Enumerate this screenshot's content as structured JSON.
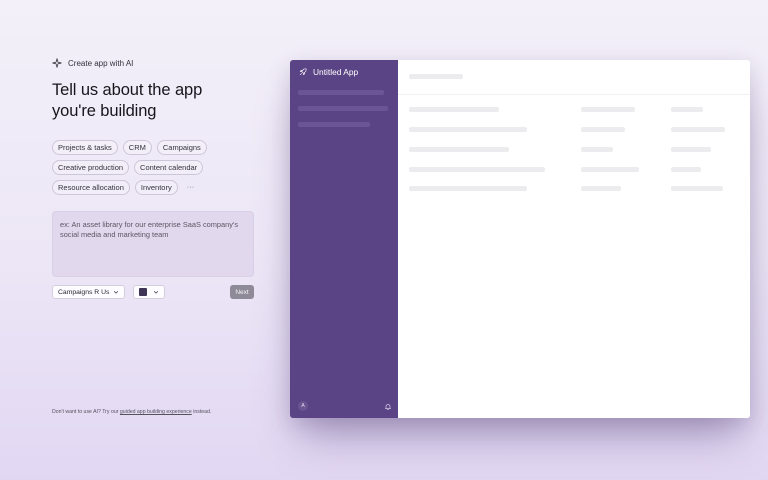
{
  "header": {
    "eyebrow": "Create app with AI",
    "title_line1": "Tell us about the app",
    "title_line2": "you're building"
  },
  "chips": [
    "Projects & tasks",
    "CRM",
    "Campaigns",
    "Creative production",
    "Content calendar",
    "Resource allocation",
    "Inventory"
  ],
  "chips_more": "···",
  "prompt": {
    "placeholder": "ex: An asset library for our enterprise SaaS company's social media and marketing team"
  },
  "controls": {
    "workspace": "Campaigns R Us",
    "swatch_color": "#3e3556",
    "next_label": "Next"
  },
  "footer": {
    "prefix": "Don't want to use AI? Try our",
    "link": "guided app building experience",
    "suffix": "instead."
  },
  "preview": {
    "app_name": "Untitled App",
    "avatar": "A",
    "sidebar_color": "#5b4485"
  },
  "icons": {
    "eyebrow": "sparkle-icon",
    "app": "rocket-icon",
    "chevron": "chevron-down-icon",
    "notifications": "bell-icon"
  }
}
